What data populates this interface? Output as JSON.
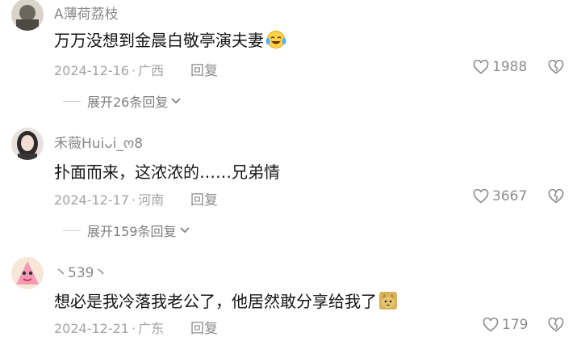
{
  "comments": [
    {
      "username": "A薄荷荔枝",
      "text": "万万没想到金晨白敬亭演夫妻",
      "date": "2024-12-16",
      "location": "广西",
      "reply_label": "回复",
      "likes": "1988",
      "expand_label": "展开26条回复"
    },
    {
      "username": "禾薇Huiᴗi_ო8",
      "text": "扑面而来，这浓浓的……兄弟情",
      "date": "2024-12-17",
      "location": "河南",
      "reply_label": "回复",
      "likes": "3667",
      "expand_label": "展开159条回复"
    },
    {
      "username": "丶539丶",
      "text": "想必是我冷落我老公了，他居然敢分享给我了",
      "date": "2024-12-21",
      "location": "广东",
      "reply_label": "回复",
      "likes": "179"
    }
  ],
  "separator": "·",
  "icons": {
    "like": "heart-outline-icon",
    "dislike": "broken-heart-icon",
    "expand": "chevron-down-icon",
    "emoji_laugh": "laughing-tears-emoji",
    "emoji_cat": "cat-sticker-emoji"
  }
}
